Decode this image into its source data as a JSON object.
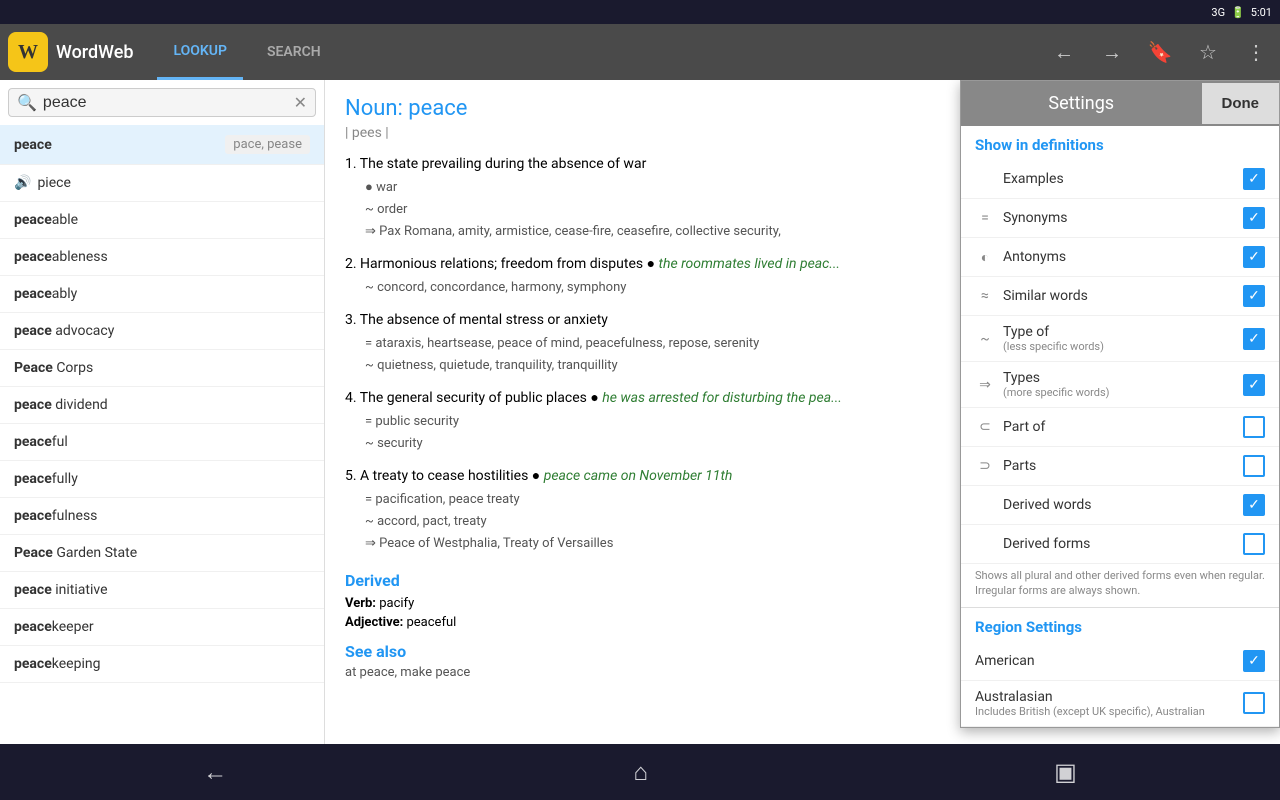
{
  "statusBar": {
    "network": "3G",
    "battery": "🔋",
    "time": "5:01"
  },
  "appBar": {
    "appName": "WordWeb",
    "tabLookup": "LOOKUP",
    "tabSearch": "SEARCH"
  },
  "search": {
    "value": "peace",
    "placeholder": "peace"
  },
  "wordList": {
    "selectedWord": "peace",
    "selectedHint": "pace, pease",
    "items": [
      {
        "prefix": "",
        "word": "peace",
        "suffix": "",
        "hint": "pace, pease",
        "sound": true
      },
      {
        "prefix": "",
        "word": "piece",
        "suffix": "",
        "sound": true
      },
      {
        "prefix": "peace",
        "word": "able",
        "suffix": ""
      },
      {
        "prefix": "peace",
        "word": "ableness",
        "suffix": ""
      },
      {
        "prefix": "peace",
        "word": "ably",
        "suffix": ""
      },
      {
        "prefix": "peace",
        "word": " advocacy",
        "suffix": ""
      },
      {
        "prefix": "Peace",
        "word": " Corps",
        "suffix": ""
      },
      {
        "prefix": "peace",
        "word": " dividend",
        "suffix": ""
      },
      {
        "prefix": "peace",
        "word": "ful",
        "suffix": ""
      },
      {
        "prefix": "peace",
        "word": "fully",
        "suffix": ""
      },
      {
        "prefix": "peace",
        "word": "fulness",
        "suffix": ""
      },
      {
        "prefix": "Peace",
        "word": " Garden State",
        "suffix": ""
      },
      {
        "prefix": "peace",
        "word": " initiative",
        "suffix": ""
      },
      {
        "prefix": "peace",
        "word": "keeper",
        "suffix": ""
      },
      {
        "prefix": "peace",
        "word": "keeping",
        "suffix": ""
      }
    ]
  },
  "definition": {
    "noun": "Noun: peace",
    "pronunciation": "| pees |",
    "senses": [
      {
        "num": "1.",
        "text": "The state prevailing during the absence of war",
        "related": [
          {
            "sym": "●",
            "word": "war"
          },
          {
            "sym": "~",
            "word": "order"
          },
          {
            "sym": "⇒",
            "words": "Pax Romana, amity, armistice, cease-fire, ceasefire, collective security,"
          }
        ]
      },
      {
        "num": "2.",
        "text": "Harmonious relations; freedom from disputes",
        "example": "the roommates lived in peac...",
        "related": [
          {
            "sym": "~",
            "words": "concord, concordance, harmony, symphony"
          }
        ]
      },
      {
        "num": "3.",
        "text": "The absence of mental stress or anxiety",
        "related": [
          {
            "sym": "=",
            "words": "ataraxis, heartsease, peace of mind, peacefulness, repose, serenity"
          },
          {
            "sym": "~",
            "words": "quietness, quietude, tranquility, tranquillity"
          }
        ]
      },
      {
        "num": "4.",
        "text": "The general security of public places",
        "example": "he was arrested for disturbing the pea...",
        "related": [
          {
            "sym": "=",
            "words": "public security"
          },
          {
            "sym": "~",
            "words": "security"
          }
        ]
      },
      {
        "num": "5.",
        "text": "A treaty to cease hostilities",
        "example": "peace came on November 11th",
        "related": [
          {
            "sym": "=",
            "words": "pacification, peace treaty"
          },
          {
            "sym": "~",
            "words": "accord, pact, treaty"
          },
          {
            "sym": "⇒",
            "words": "Peace of Westphalia, Treaty of Versailles"
          }
        ]
      }
    ],
    "derived": {
      "title": "Derived",
      "verb": "Verb: pacify",
      "adjective": "Adjective: peaceful"
    },
    "seeAlso": {
      "title": "See also",
      "items": "at peace, make peace"
    }
  },
  "settings": {
    "title": "Settings",
    "doneLabel": "Done",
    "showInDefinitions": "Show in definitions",
    "items": [
      {
        "label": "Examples",
        "icon": "",
        "checked": true
      },
      {
        "label": "Synonyms",
        "icon": "=",
        "checked": true
      },
      {
        "label": "Antonyms",
        "icon": "◐",
        "checked": true
      },
      {
        "label": "Similar words",
        "icon": "≈",
        "checked": true
      },
      {
        "label": "Type of",
        "sublabel": "(less specific words)",
        "icon": "~",
        "checked": true
      },
      {
        "label": "Types",
        "sublabel": "(more specific words)",
        "icon": "⇒",
        "checked": true
      },
      {
        "label": "Part of",
        "icon": "⊂",
        "checked": false
      },
      {
        "label": "Parts",
        "icon": "⊃",
        "checked": false
      },
      {
        "label": "Derived words",
        "icon": "",
        "checked": true
      },
      {
        "label": "Derived forms",
        "icon": "",
        "checked": false,
        "note": "Shows all plural and other derived forms even when regular. Irregular forms are always shown."
      }
    ],
    "regionSettings": "Region Settings",
    "regions": [
      {
        "label": "American",
        "checked": true
      },
      {
        "label": "Australasian",
        "checked": false,
        "sublabel": "Includes British (except UK specific), Australian"
      }
    ]
  },
  "bottomNav": {
    "back": "←",
    "home": "⌂",
    "recent": "▣"
  }
}
